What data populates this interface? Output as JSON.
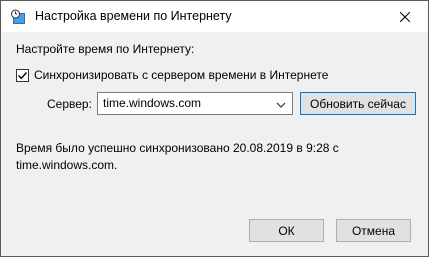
{
  "window": {
    "title": "Настройка времени по Интернету",
    "icon": "clock-globe-icon",
    "close_icon": "close-icon"
  },
  "content": {
    "heading": "Настройте время по Интернету:",
    "sync_checkbox": {
      "label": "Синхронизировать с сервером времени в Интернете",
      "checked": true
    },
    "server_label": "Сервер:",
    "server_value": "time.windows.com",
    "update_button": "Обновить сейчас",
    "status_line1": "Время было успешно синхронизовано 20.08.2019 в 9:28 с",
    "status_line2": "time.windows.com."
  },
  "footer": {
    "ok_label": "ОК",
    "cancel_label": "Отмена"
  },
  "colors": {
    "accent": "#0078d7",
    "dialog_bg": "#f0f0f0",
    "titlebar_bg": "#ffffff"
  }
}
